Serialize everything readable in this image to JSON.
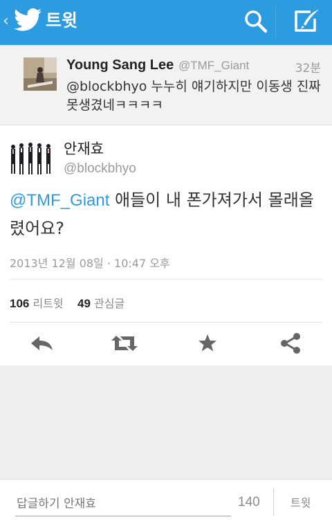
{
  "header": {
    "back_glyph": "‹",
    "title": "트윗",
    "bird_icon": "twitter-bird-icon",
    "search_icon": "search-icon",
    "compose_icon": "compose-icon",
    "bar_color": "#2d9be0"
  },
  "parent_tweet": {
    "name": "Young Sang Lee",
    "handle": "@TMF_Giant",
    "time": "32분",
    "text": "@blockbhyo 누누히 얘기하지만 이동생 진짜못생겼네ㅋㅋㅋㅋ"
  },
  "tweet": {
    "name": "안재효",
    "handle": "@blockbhyo",
    "mention": "@TMF_Giant",
    "text": " 애들이 내 폰가져가서 몰래올렸어요?",
    "date": "2013년 12월 08일 · 10:47 오후",
    "retweet_count": "106",
    "retweet_label": "리트윗",
    "favorite_count": "49",
    "favorite_label": "관심글",
    "mention_color": "#2d9be0"
  },
  "actions": {
    "reply_icon": "reply-icon",
    "retweet_icon": "retweet-icon",
    "favorite_icon": "star-icon",
    "share_icon": "share-icon"
  },
  "composer": {
    "placeholder": "답글하기 안재효",
    "char_count": "140",
    "send_label": "트윗"
  }
}
